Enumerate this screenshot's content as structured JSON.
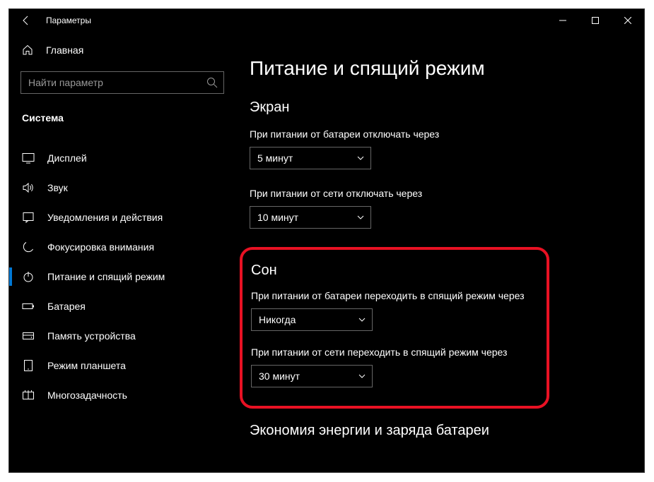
{
  "window": {
    "title": "Параметры"
  },
  "sidebar": {
    "home": "Главная",
    "search_placeholder": "Найти параметр",
    "category": "Система",
    "items": [
      {
        "label": "Дисплей"
      },
      {
        "label": "Звук"
      },
      {
        "label": "Уведомления и действия"
      },
      {
        "label": "Фокусировка внимания"
      },
      {
        "label": "Питание и спящий режим"
      },
      {
        "label": "Батарея"
      },
      {
        "label": "Память устройства"
      },
      {
        "label": "Режим планшета"
      },
      {
        "label": "Многозадачность"
      }
    ]
  },
  "content": {
    "title": "Питание и спящий режим",
    "screen_heading": "Экран",
    "screen_battery_label": "При питании от батареи отключать через",
    "screen_battery_value": "5 минут",
    "screen_plugged_label": "При питании от сети отключать через",
    "screen_plugged_value": "10 минут",
    "sleep_heading": "Сон",
    "sleep_battery_label": "При питании от батареи переходить в спящий режим через",
    "sleep_battery_value": "Никогда",
    "sleep_plugged_label": "При питании от сети переходить в спящий режим через",
    "sleep_plugged_value": "30 минут",
    "battery_heading": "Экономия энергии и заряда батареи"
  }
}
